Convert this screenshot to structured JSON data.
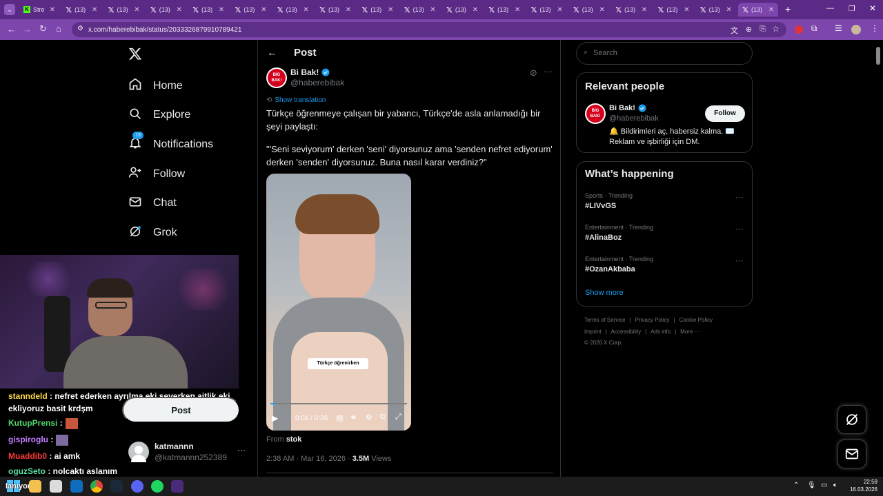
{
  "browser": {
    "tabs": [
      {
        "label": "Stre",
        "favicon": "kick-icon",
        "active": false
      },
      {
        "label": "(13)",
        "favicon": "x-icon",
        "active": false
      },
      {
        "label": "(13)",
        "favicon": "x-icon",
        "active": false
      },
      {
        "label": "(13)",
        "favicon": "x-icon",
        "active": false
      },
      {
        "label": "(13)",
        "favicon": "x-icon",
        "active": false
      },
      {
        "label": "(13)",
        "favicon": "x-icon",
        "active": false
      },
      {
        "label": "(13)",
        "favicon": "x-icon",
        "active": false
      },
      {
        "label": "(13)",
        "favicon": "x-icon",
        "active": false
      },
      {
        "label": "(13)",
        "favicon": "x-icon",
        "active": false
      },
      {
        "label": "(13)",
        "favicon": "x-icon",
        "active": false
      },
      {
        "label": "(13)",
        "favicon": "x-icon",
        "active": false
      },
      {
        "label": "(13)",
        "favicon": "x-icon",
        "active": false
      },
      {
        "label": "(13)",
        "favicon": "x-icon",
        "active": false
      },
      {
        "label": "(13)",
        "favicon": "x-icon",
        "active": false
      },
      {
        "label": "(13)",
        "favicon": "x-icon",
        "active": false
      },
      {
        "label": "(13)",
        "favicon": "x-icon",
        "active": false
      },
      {
        "label": "(13)",
        "favicon": "x-icon",
        "active": false
      },
      {
        "label": "(13)",
        "favicon": "x-icon",
        "active": true
      }
    ],
    "url": "x.com/haberebibak/status/2033326879910789421",
    "theme_color": "#7d46ad"
  },
  "sidebar": {
    "items": [
      {
        "label": "Home",
        "icon": "home-icon"
      },
      {
        "label": "Explore",
        "icon": "search-icon"
      },
      {
        "label": "Notifications",
        "icon": "bell-icon",
        "badge": "13"
      },
      {
        "label": "Follow",
        "icon": "add-user-icon"
      },
      {
        "label": "Chat",
        "icon": "mail-icon"
      },
      {
        "label": "Grok",
        "icon": "grok-icon"
      }
    ],
    "post_label": "Post",
    "account": {
      "name": "katmannn",
      "handle": "@katmannn252389"
    }
  },
  "chat": [
    {
      "user": "stanndeld",
      "text": ": nefret ederken ayrılma eki severken aitlik eki",
      "color": "#ffd84d"
    },
    {
      "user": "",
      "text": "ekliyoruz basit krdşm",
      "color": "#ffffff"
    },
    {
      "user": "KutupPrensi",
      "text": ":",
      "color": "#53d769"
    },
    {
      "user": "gispiroglu",
      "text": ":",
      "color": "#c77dff"
    },
    {
      "user": "Muaddib0",
      "text": ": ai amk",
      "color": "#ff3b3b"
    },
    {
      "user": "oguzSeto",
      "text": ": nolcaktı aslanım",
      "color": "#5ee0a0"
    }
  ],
  "post": {
    "header_title": "Post",
    "author_name": "Bi Bak!",
    "author_handle": "@haberebibak",
    "avatar_text": "BİG BAK!",
    "show_translation": "Show translation",
    "text_line1": "Türkçe öğrenmeye çalışan bir yabancı, Türkçe'de asla anlamadığı bir şeyi paylaştı:",
    "text_line2": "\"'Seni seviyorum' derken 'seni' diyorsunuz ama 'senden nefret ediyorum' derken 'senden' diyorsunuz. Buna nasıl karar verdiniz?\"",
    "video": {
      "caption": "Türkçe öğrenirken",
      "time": "0:01 / 0:26",
      "progress": 0.04
    },
    "from_label": "From",
    "from_source": "stok",
    "timestamp": "2:38 AM · Mar 16, 2026 ·",
    "views_count": "3.5M",
    "views_label": "Views"
  },
  "right": {
    "search_placeholder": "Search",
    "relevant_title": "Relevant people",
    "person": {
      "name": "Bi Bak!",
      "handle": "@haberebibak",
      "bio": "🔔 Bildirimleri aç, habersiz kalma. ✉️ Reklam ve işbirliği için DM.",
      "follow_label": "Follow"
    },
    "happening_title": "What’s happening",
    "trends": [
      {
        "category": "Sports · Trending",
        "name": "#LIVvGS"
      },
      {
        "category": "Entertainment · Trending",
        "name": "#AlinaBoz"
      },
      {
        "category": "Entertainment · Trending",
        "name": "#OzanAkbaba"
      }
    ],
    "show_more": "Show more",
    "footer_line1": [
      "Terms of Service",
      "Privacy Policy",
      "Cookie Policy"
    ],
    "footer_line2": [
      "Imprint",
      "Accessibility",
      "Ads info",
      "More ···"
    ],
    "copyright": "© 2026 X Corp."
  },
  "taskbar": {
    "time": "22:59",
    "date": "16.03.2026",
    "start_label": "lanıyorum"
  }
}
